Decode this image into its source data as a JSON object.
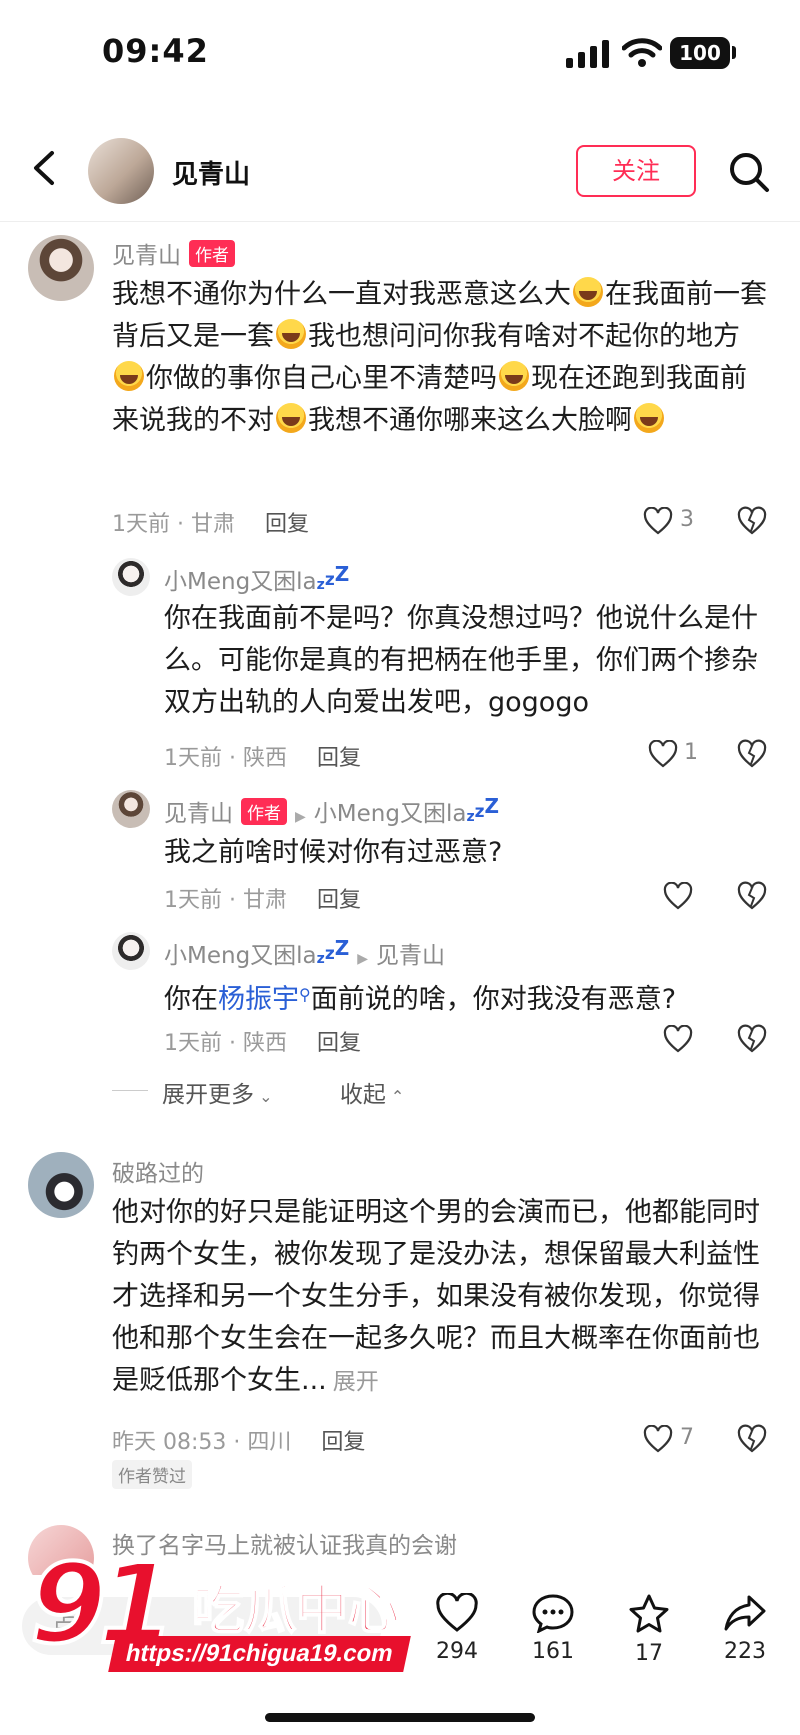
{
  "status": {
    "time": "09:42",
    "battery": "100"
  },
  "header": {
    "name": "见青山",
    "follow": "关注"
  },
  "comments": [
    {
      "user": "见青山",
      "badge": "作者",
      "segments": [
        "我想不通你为什么一直对我恶意这么大",
        "在我面前一套背后又是一套",
        "我也想问问你我有啥对不起你的地方",
        "你做的事你自己心里不清楚吗",
        "现在还跑到我面前来说我的不对",
        "我想不通你哪来这么大脸啊"
      ],
      "time_loc": "1天前 · 甘肃",
      "reply": "回复",
      "likes": "3"
    }
  ],
  "replies": [
    {
      "user": "小Meng又困la",
      "zz": [
        "z",
        "z",
        "Z"
      ],
      "text": "你在我面前不是吗？你真没想过吗？他说什么是什么。可能你是真的有把柄在他手里，你们两个掺杂双方出轨的人向爱出发吧，gogogo",
      "time_loc": "1天前 · 陕西",
      "reply": "回复",
      "likes": "1"
    },
    {
      "user": "见青山",
      "badge": "作者",
      "to": "小Meng又困la",
      "text": "我之前啥时候对你有过恶意?",
      "time_loc": "1天前 · 甘肃",
      "reply": "回复"
    },
    {
      "user": "小Meng又困la",
      "to": "见青山",
      "text_before": "你在",
      "mention": "杨振宇",
      "text_after": "面前说的啥，你对我没有恶意?",
      "time_loc": "1天前 · 陕西",
      "reply": "回复"
    }
  ],
  "expand": {
    "more": "展开更多",
    "collapse": "收起"
  },
  "comment2": {
    "user": "破路过的",
    "text": "他对你的好只是能证明这个男的会演而已，他都能同时钓两个女生，被你发现了是没办法，想保留最大利益性才选择和另一个女生分手，如果没有被你发现，你觉得他和那个女生会在一起多久呢？而且大概率在你面前也是贬低那个女生...",
    "expand": "展开",
    "time_loc": "昨天 08:53 · 四川",
    "reply": "回复",
    "likes": "7",
    "author_liked": "作者赞过"
  },
  "comment3": {
    "user": "换了名字马上就被认证我真的会谢"
  },
  "bottom": {
    "placeholder": "点",
    "likes": "294",
    "comments": "161",
    "stars": "17",
    "shares": "223"
  },
  "watermark": {
    "logo": "91",
    "name": "吃瓜中心",
    "url": "https://91chigua19.com"
  },
  "colors": {
    "accent": "#ff2d55",
    "link": "#2a5fd6",
    "watermark": "#e8102d"
  }
}
